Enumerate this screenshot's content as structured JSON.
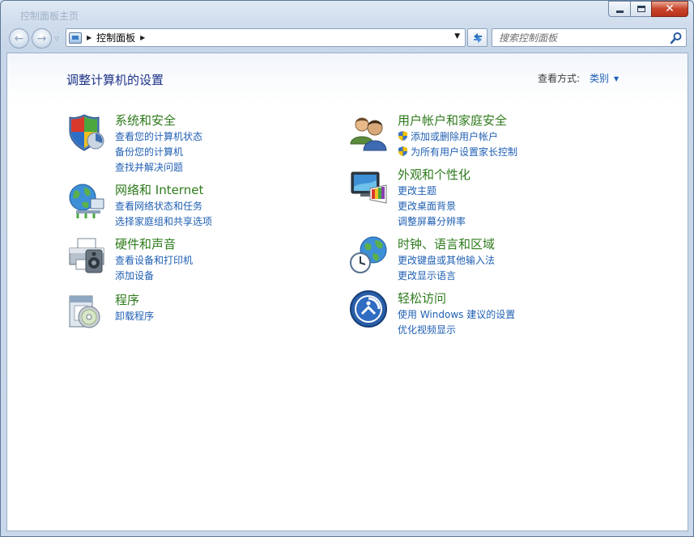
{
  "window": {
    "title": "控制面板主页",
    "controls": {
      "minimize": "minimize",
      "maximize": "maximize",
      "close": "✕"
    }
  },
  "nav": {
    "back": "←",
    "forward": "→",
    "breadcrumb": [
      {
        "label": "控制面板"
      }
    ],
    "search_placeholder": "搜索控制面板"
  },
  "header": {
    "title": "调整计算机的设置",
    "view_by_label": "查看方式:",
    "view_by_value": "类别"
  },
  "categories": [
    {
      "title": "系统和安全",
      "icon": "shield-icon",
      "links": [
        "查看您的计算机状态",
        "备份您的计算机",
        "查找并解决问题"
      ]
    },
    {
      "title": "网络和 Internet",
      "icon": "globe-network-icon",
      "links": [
        "查看网络状态和任务",
        "选择家庭组和共享选项"
      ]
    },
    {
      "title": "硬件和声音",
      "icon": "printer-icon",
      "links": [
        "查看设备和打印机",
        "添加设备"
      ]
    },
    {
      "title": "程序",
      "icon": "programs-icon",
      "links": [
        "卸载程序"
      ]
    },
    {
      "title": "用户帐户和家庭安全",
      "icon": "users-icon",
      "links": [
        "添加或删除用户帐户",
        "为所有用户设置家长控制"
      ]
    },
    {
      "title": "外观和个性化",
      "icon": "monitor-palette-icon",
      "links": [
        "更改主题",
        "更改桌面背景",
        "调整屏幕分辨率"
      ]
    },
    {
      "title": "时钟、语言和区域",
      "icon": "clock-globe-icon",
      "links": [
        "更改键盘或其他输入法",
        "更改显示语言"
      ]
    },
    {
      "title": "轻松访问",
      "icon": "ease-of-access-icon",
      "links": [
        "使用 Windows 建议的设置",
        "优化视频显示"
      ]
    }
  ],
  "colors": {
    "category_title": "#2d7a1b",
    "link": "#1f5fb3",
    "page_title": "#1e3287"
  }
}
